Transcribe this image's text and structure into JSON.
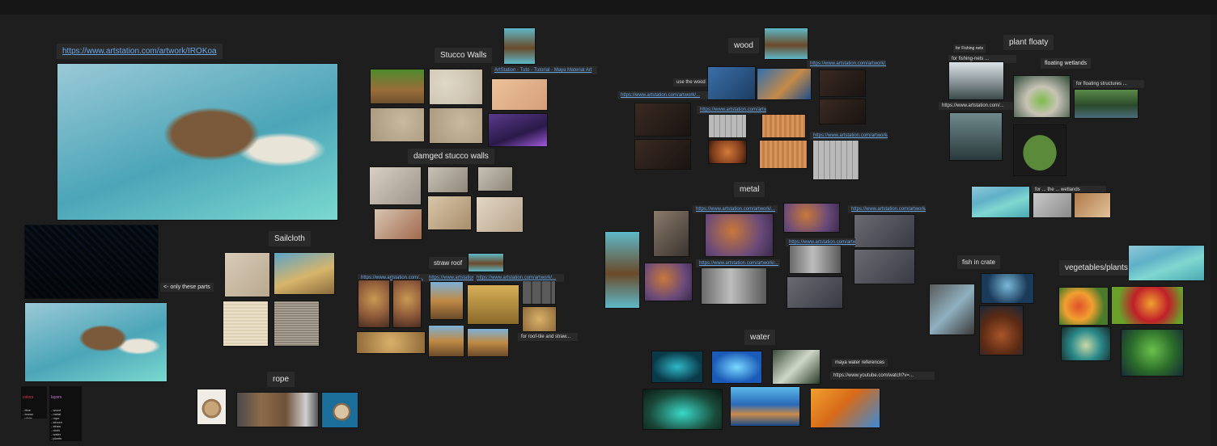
{
  "main_link": "https://www.artstation.com/artwork/IROKoa",
  "annotations": {
    "only_these_parts": "<- only these parts"
  },
  "labels": {
    "sailcloth": "Sailcloth",
    "rope": "rope",
    "stucco_walls": "Stucco Walls",
    "damged_stucco": "damged stucco walls",
    "straw_roof": "straw roof",
    "wood": "wood",
    "metal": "metal",
    "water": "water",
    "plant_floaty": "plant floaty",
    "floating_wetlands": "floating wetlands",
    "fish_in_crate": "fish in crate",
    "vegetables_plants": "vegetables/plants",
    "maya_water_reference": "maya water references",
    "fishing_nets": "for Fishing nets"
  },
  "small_links": {
    "stucco_tutorial": "ArtStation - Tuto - Tutorial - Maya Material Art",
    "wood_link_1": "https://www.artstation.com/artwork/...",
    "wood_link_2": "use the wood ...",
    "wood_link_3": "https://www.artstation.com/artwork/...",
    "wood_link_4": "https://www.artstation.com/artwork/...",
    "wood_link_5": "https://www.artstation.com/artwork/...",
    "metal_link_1": "https://www.artstation.com/artwork/...",
    "metal_link_2": "https://www.artstation.com/artwork/...",
    "metal_link_3": "https://www.artstation.com/artwork/...",
    "metal_link_4": "https://www.artstation.com/artwork/...",
    "straw_link_1": "https://www.artstation.com/...",
    "straw_link_2": "https://www.artstation.com/...",
    "straw_link_3": "https://www.artstation.com/artwork/...",
    "straw_note": "for roof-tile and straw...",
    "water_link": "https://www.youtube.com/watch?v=...",
    "float_link_1": "for fishing-nets ...",
    "float_link_2": "for floating structures ...",
    "float_link_3": "https://www.artstation.com/...",
    "float_link_4": "for ... the ... wetlands"
  },
  "notes": {
    "left_red_title": "colors",
    "left_pink_title": "layers",
    "left_lines": "- blue\n- brown\n- white\n- green\n- teal",
    "right_lines": "- wood\n- metal\n- rope\n- stucco\n- straw\n- cloth\n- water\n- plants\n- fish\n- crate\n- veg"
  }
}
